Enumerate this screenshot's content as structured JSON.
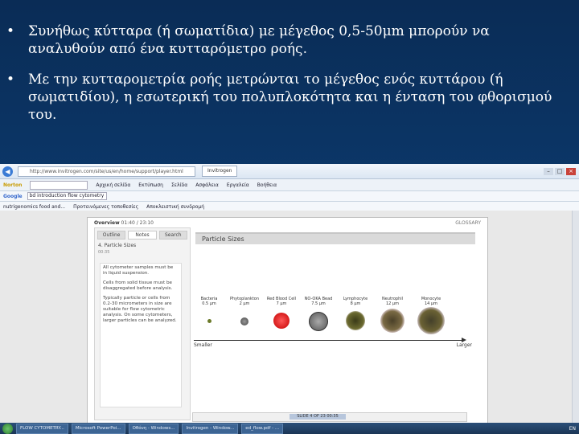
{
  "slide": {
    "bullets": [
      {
        "marker": "•",
        "text": "Συνήθως κύτταρα (ή σωματίδια) με μέγεθος 0,5-50μm μπορούν να αναλυθούν από ένα κυτταρόμετρο ροής."
      },
      {
        "marker": "•",
        "text": "Με την κυτταρομετρία ροής μετρώνται το μέγεθος ενός κυττάρου (ή σωματιδίου), η εσωτερική του πολυπλοκότητα και η ένταση του φθορισμού του."
      }
    ]
  },
  "browser": {
    "back_icon": "back-arrow-icon",
    "url": "http://www.invitrogen.com/site/us/en/home/support/player.html",
    "tab_title": "Invitrogen",
    "window_controls": [
      "–",
      "□",
      "×"
    ],
    "toolbar_items": [
      "Norton",
      "Αρχική σελίδα",
      "Εκτύπωση",
      "Σελίδα",
      "Ασφάλεια",
      "Εργαλεία",
      "Βοήθεια"
    ],
    "favorites": [
      "nutrigenomics food and...",
      "Προτεινόμενες τοποθεσίες",
      "Αποκλειστική συνδρομή"
    ],
    "google_label": "Google",
    "google_query": "bd introduction flow cytometry"
  },
  "player": {
    "overview_label": "Overview",
    "overview_time": "01:40 / 23:10",
    "glossary_label": "GLOSSARY",
    "tabs": [
      "Outline",
      "Notes",
      "Search"
    ],
    "active_tab": "Notes",
    "section_title": "4. Particle Sizes",
    "section_time": "00:35",
    "notes": [
      "All cytometer samples must be in liquid suspension.",
      "Cells from solid tissue must be disaggregated before analysis.",
      "Typically particle or cells from 0.2-30 micrometers in size are suitable for flow cytometric analysis. On some cytometers, larger particles can be analyzed."
    ],
    "slide_title": "Particle Sizes",
    "particles": [
      {
        "name": "Bacteria",
        "size": "0.5 µm",
        "color": "#6b7a2a"
      },
      {
        "name": "Phytoplankton",
        "size": "2 µm",
        "color": "#555555"
      },
      {
        "name": "Red Blood Cell",
        "size": "7 µm",
        "color": "#e01818"
      },
      {
        "name": "NO-OKA Bead",
        "size": "7.5 µm",
        "color": "#7a7a7a"
      },
      {
        "name": "Lymphocyte",
        "size": "8 µm",
        "color": "#4a4a22"
      },
      {
        "name": "Neutrophil",
        "size": "12 µm",
        "color": "#5a5030"
      },
      {
        "name": "Monocyte",
        "size": "14 µm",
        "color": "#4d4a2a"
      }
    ],
    "smaller_label": "Smaller",
    "larger_label": "Larger",
    "timeline_label": "SLIDE 4 OF 23  00:35"
  },
  "taskbar": {
    "items": [
      "FLOW CYTOMETRY...",
      "Microsoft PowerPoi...",
      "Οθόνη - Windows...",
      "Invitrogen - Window...",
      "ed_flow.pdf - ..."
    ],
    "tray": "EN"
  }
}
